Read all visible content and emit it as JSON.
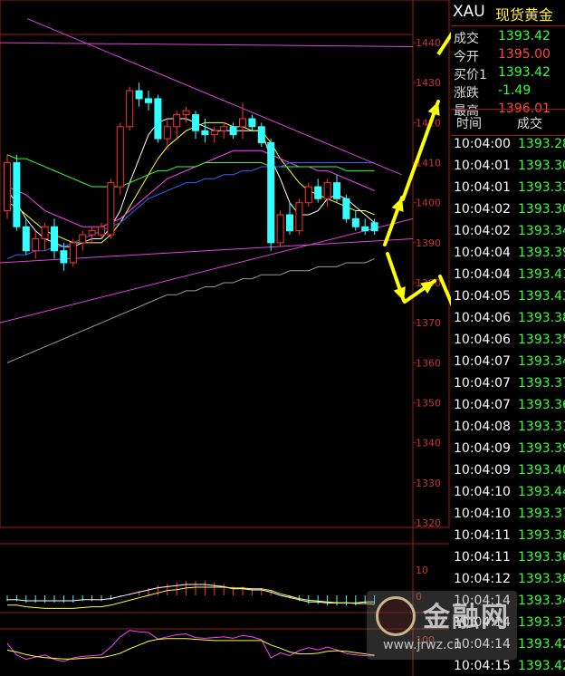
{
  "quote_panel": {
    "symbol": "XAU",
    "name": "现货黄金",
    "rows": [
      {
        "label": "成交",
        "value": "1393.42",
        "color": "#33ff33"
      },
      {
        "label": "今开",
        "value": "1395.00",
        "color": "#ff4444"
      },
      {
        "label": "买价1",
        "value": "1393.42",
        "color": "#33ff33"
      },
      {
        "label": "涨跌",
        "value": "-1.49",
        "color": "#33ff33"
      },
      {
        "label": "最高",
        "value": "1396.01",
        "color": "#ff4444"
      }
    ]
  },
  "ticks": {
    "header_time": "时间",
    "header_deal": "成交",
    "rows": [
      {
        "time": "10:04:00",
        "price": "1393.28"
      },
      {
        "time": "10:04:01",
        "price": "1393.30"
      },
      {
        "time": "10:04:01",
        "price": "1393.33"
      },
      {
        "time": "10:04:02",
        "price": "1393.30"
      },
      {
        "time": "10:04:02",
        "price": "1393.34"
      },
      {
        "time": "10:04:04",
        "price": "1393.39"
      },
      {
        "time": "10:04:04",
        "price": "1393.41"
      },
      {
        "time": "10:04:05",
        "price": "1393.43"
      },
      {
        "time": "10:04:06",
        "price": "1393.38"
      },
      {
        "time": "10:04:06",
        "price": "1393.35"
      },
      {
        "time": "10:04:07",
        "price": "1393.34"
      },
      {
        "time": "10:04:07",
        "price": "1393.37"
      },
      {
        "time": "10:04:07",
        "price": "1393.36"
      },
      {
        "time": "10:04:08",
        "price": "1393.31"
      },
      {
        "time": "10:04:09",
        "price": "1393.39"
      },
      {
        "time": "10:04:09",
        "price": "1393.40"
      },
      {
        "time": "10:04:10",
        "price": "1393.44"
      },
      {
        "time": "10:04:10",
        "price": "1393.37"
      },
      {
        "time": "10:04:11",
        "price": "1393.38"
      },
      {
        "time": "10:04:11",
        "price": "1393.36"
      },
      {
        "time": "10:04:12",
        "price": "1393.38"
      },
      {
        "time": "10:04:14",
        "price": "1393.34"
      },
      {
        "time": "10:04:14",
        "price": "1393.37"
      },
      {
        "time": "10:04:14",
        "price": "1393.42"
      },
      {
        "time": "10:04:15",
        "price": "1393.42"
      }
    ]
  },
  "watermark": {
    "text": "金融网",
    "url": "www.jrwz.cn"
  },
  "chart_data": {
    "type": "candlestick",
    "ylim": [
      1320,
      1445
    ],
    "y_ticks": [
      1320,
      1330,
      1340,
      1350,
      1360,
      1370,
      1380,
      1390,
      1400,
      1410,
      1420,
      1430,
      1440
    ],
    "up_color": "#ff3333",
    "down_color": "#33ffff",
    "candles": [
      {
        "o": 1398,
        "h": 1412,
        "l": 1396,
        "c": 1410
      },
      {
        "o": 1410,
        "h": 1412,
        "l": 1393,
        "c": 1394
      },
      {
        "o": 1394,
        "h": 1396,
        "l": 1387,
        "c": 1388
      },
      {
        "o": 1388,
        "h": 1393,
        "l": 1386,
        "c": 1391
      },
      {
        "o": 1391,
        "h": 1395,
        "l": 1388,
        "c": 1394
      },
      {
        "o": 1394,
        "h": 1396,
        "l": 1386,
        "c": 1388
      },
      {
        "o": 1388,
        "h": 1390,
        "l": 1383,
        "c": 1385
      },
      {
        "o": 1385,
        "h": 1391,
        "l": 1384,
        "c": 1390
      },
      {
        "o": 1390,
        "h": 1393,
        "l": 1388,
        "c": 1392
      },
      {
        "o": 1392,
        "h": 1394,
        "l": 1390,
        "c": 1393
      },
      {
        "o": 1392,
        "h": 1395,
        "l": 1391,
        "c": 1394
      },
      {
        "o": 1392,
        "h": 1406,
        "l": 1391,
        "c": 1405
      },
      {
        "o": 1404,
        "h": 1420,
        "l": 1402,
        "c": 1419
      },
      {
        "o": 1419,
        "h": 1429,
        "l": 1418,
        "c": 1428
      },
      {
        "o": 1428,
        "h": 1430,
        "l": 1424,
        "c": 1426
      },
      {
        "o": 1426,
        "h": 1428,
        "l": 1423,
        "c": 1425
      },
      {
        "o": 1426,
        "h": 1427,
        "l": 1415,
        "c": 1416
      },
      {
        "o": 1416,
        "h": 1421,
        "l": 1414,
        "c": 1419
      },
      {
        "o": 1419,
        "h": 1423,
        "l": 1416,
        "c": 1422
      },
      {
        "o": 1422,
        "h": 1424,
        "l": 1420,
        "c": 1423
      },
      {
        "o": 1422,
        "h": 1423,
        "l": 1416,
        "c": 1418
      },
      {
        "o": 1418,
        "h": 1421,
        "l": 1415,
        "c": 1417
      },
      {
        "o": 1417,
        "h": 1419,
        "l": 1415,
        "c": 1418
      },
      {
        "o": 1418,
        "h": 1420,
        "l": 1416,
        "c": 1419
      },
      {
        "o": 1419,
        "h": 1420,
        "l": 1416,
        "c": 1417
      },
      {
        "o": 1419,
        "h": 1425,
        "l": 1416,
        "c": 1421
      },
      {
        "o": 1421,
        "h": 1422,
        "l": 1418,
        "c": 1419
      },
      {
        "o": 1419,
        "h": 1420,
        "l": 1414,
        "c": 1415
      },
      {
        "o": 1415,
        "h": 1416,
        "l": 1388,
        "c": 1390
      },
      {
        "o": 1390,
        "h": 1398,
        "l": 1389,
        "c": 1397
      },
      {
        "o": 1397,
        "h": 1400,
        "l": 1392,
        "c": 1393
      },
      {
        "o": 1393,
        "h": 1401,
        "l": 1392,
        "c": 1400
      },
      {
        "o": 1400,
        "h": 1405,
        "l": 1399,
        "c": 1404
      },
      {
        "o": 1404,
        "h": 1406,
        "l": 1400,
        "c": 1401
      },
      {
        "o": 1401,
        "h": 1406,
        "l": 1399,
        "c": 1405
      },
      {
        "o": 1405,
        "h": 1407,
        "l": 1400,
        "c": 1401
      },
      {
        "o": 1401,
        "h": 1402,
        "l": 1395,
        "c": 1396
      },
      {
        "o": 1396,
        "h": 1398,
        "l": 1393,
        "c": 1394
      },
      {
        "o": 1394,
        "h": 1396,
        "l": 1392,
        "c": 1393
      },
      {
        "o": 1395,
        "h": 1396,
        "l": 1392,
        "c": 1393
      }
    ],
    "moving_averages": [
      {
        "color": "#ffffff",
        "values": [
          1403,
          1400,
          1396,
          1393,
          1391,
          1390,
          1389,
          1389,
          1390,
          1391,
          1391,
          1394,
          1398,
          1405,
          1411,
          1417,
          1420,
          1421,
          1421,
          1421,
          1420,
          1419,
          1418,
          1418,
          1418,
          1418,
          1418,
          1418,
          1411,
          1406,
          1400,
          1397,
          1397,
          1398,
          1401,
          1402,
          1401,
          1399,
          1397,
          1395
        ]
      },
      {
        "color": "#ffff33",
        "values": [
          1400,
          1399,
          1397,
          1395,
          1393,
          1392,
          1391,
          1390,
          1390,
          1390,
          1390,
          1392,
          1395,
          1399,
          1403,
          1407,
          1411,
          1414,
          1416,
          1418,
          1419,
          1420,
          1420,
          1420,
          1419,
          1419,
          1418,
          1418,
          1415,
          1411,
          1408,
          1405,
          1403,
          1402,
          1401,
          1400,
          1399,
          1398,
          1398,
          1397
        ]
      },
      {
        "color": "#ff44ff",
        "values": [
          1404,
          1403,
          1402,
          1400,
          1398,
          1397,
          1396,
          1395,
          1394,
          1394,
          1394,
          1395,
          1396,
          1398,
          1400,
          1402,
          1404,
          1406,
          1407,
          1408,
          1409,
          1410,
          1411,
          1412,
          1413,
          1413,
          1413,
          1413,
          1412,
          1411,
          1410,
          1409,
          1409,
          1408,
          1408,
          1407,
          1406,
          1405,
          1404,
          1403
        ]
      },
      {
        "color": "#33ff33",
        "values": [
          1412,
          1411,
          1411,
          1410,
          1409,
          1408,
          1407,
          1406,
          1405,
          1404,
          1404,
          1404,
          1404,
          1405,
          1406,
          1407,
          1408,
          1408,
          1409,
          1409,
          1409,
          1410,
          1410,
          1410,
          1410,
          1410,
          1410,
          1410,
          1409,
          1409,
          1409,
          1409,
          1409,
          1409,
          1409,
          1409,
          1408,
          1408,
          1408,
          1408
        ]
      },
      {
        "color": "#3366ff",
        "values": [
          1386,
          1387,
          1387,
          1388,
          1388,
          1389,
          1389,
          1390,
          1391,
          1392,
          1393,
          1394,
          1395,
          1397,
          1399,
          1401,
          1402,
          1403,
          1404,
          1405,
          1405,
          1406,
          1406,
          1407,
          1407,
          1408,
          1408,
          1409,
          1409,
          1409,
          1410,
          1410,
          1410,
          1410,
          1410,
          1410,
          1410,
          1410,
          1410,
          1410
        ]
      },
      {
        "color": "#999999",
        "values": [
          1360,
          1361,
          1362,
          1363,
          1364,
          1365,
          1366,
          1367,
          1368,
          1369,
          1370,
          1371,
          1372,
          1373,
          1374,
          1375,
          1376,
          1377,
          1377,
          1378,
          1378,
          1379,
          1379,
          1380,
          1380,
          1381,
          1381,
          1382,
          1382,
          1382,
          1383,
          1383,
          1383,
          1384,
          1384,
          1384,
          1385,
          1385,
          1385,
          1386
        ]
      }
    ],
    "trend_lines_color": "#dd44dd",
    "annotation_color": "#ffff00",
    "macd_ticks": [
      "10",
      "0"
    ],
    "lower_ticks": [
      "100"
    ]
  }
}
